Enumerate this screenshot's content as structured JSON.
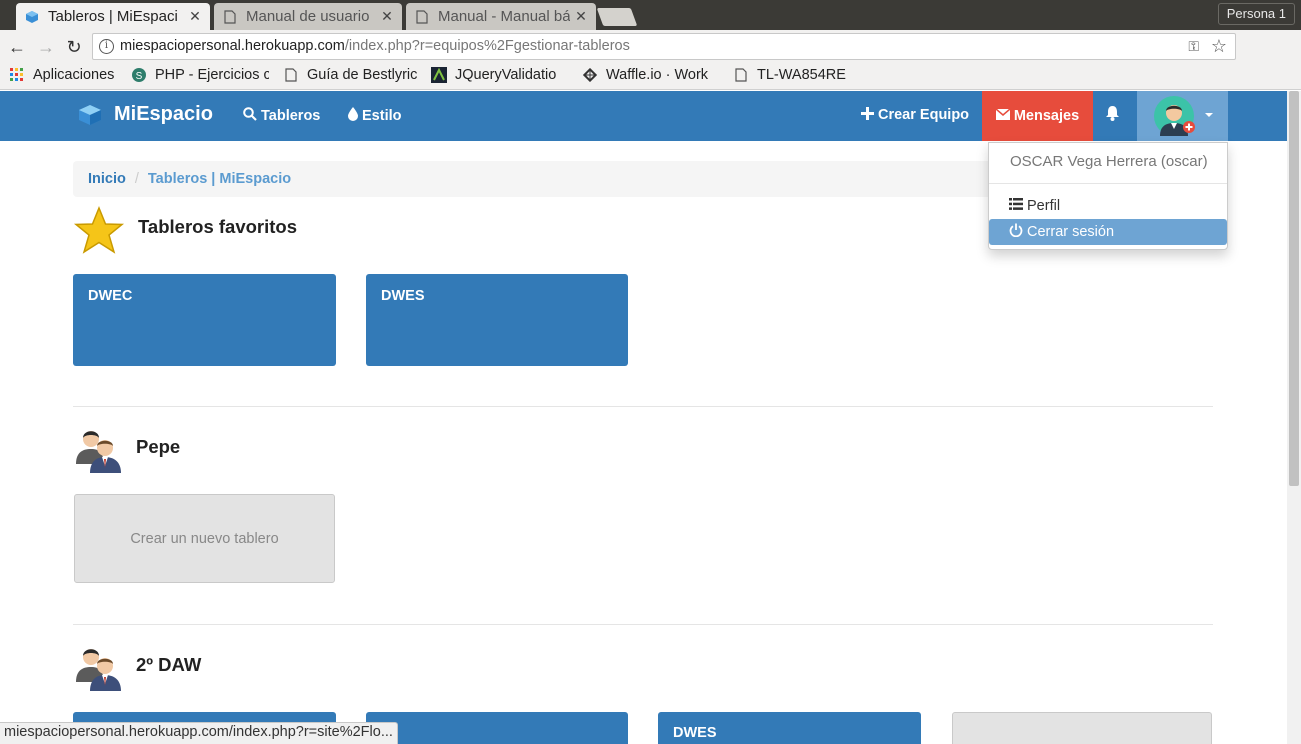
{
  "browser": {
    "tabs": [
      {
        "title": "Tableros | MiEspaci",
        "active": true
      },
      {
        "title": "Manual de usuario",
        "active": false
      },
      {
        "title": "Manual - Manual bá",
        "active": false
      }
    ],
    "profile": "Persona 1",
    "url": {
      "host": "miespaciopersonal.herokuapp.com",
      "path": "/index.php?r=equipos%2Fgestionar-tableros"
    },
    "bookmarks": [
      {
        "label": "Aplicaciones",
        "icon": "apps-grid-icon"
      },
      {
        "label": "PHP - Ejercicios c",
        "icon": "site-favicon"
      },
      {
        "label": "Guía de Bestlyric",
        "icon": "page-icon"
      },
      {
        "label": "JQueryValidatio",
        "icon": "site-favicon"
      },
      {
        "label": "Waffle.io · Work",
        "icon": "waffle-icon"
      },
      {
        "label": "TL-WA854RE",
        "icon": "page-icon"
      }
    ]
  },
  "navbar": {
    "brand": "MiEspacio",
    "links": [
      {
        "label": "Tableros",
        "icon": "search-icon"
      },
      {
        "label": "Estilo",
        "icon": "droplet-icon"
      }
    ],
    "crear_equipo": "Crear Equipo",
    "mensajes": "Mensajes",
    "colors": {
      "navbar": "#337ab7",
      "mensajes": "#e74c3c",
      "active": "#6ea4d3"
    }
  },
  "user_menu": {
    "name": "OSCAR Vega Herrera (oscar)",
    "items": [
      {
        "label": "Perfil",
        "icon": "list-icon"
      },
      {
        "label": "Cerrar sesión",
        "icon": "power-icon"
      }
    ]
  },
  "breadcrumb": {
    "home": "Inicio",
    "current": "Tableros | MiEspacio"
  },
  "sections": {
    "favoritos": {
      "title": "Tableros favoritos",
      "boards": [
        "DWEC",
        "DWES"
      ]
    },
    "pepe": {
      "title": "Pepe",
      "new_board": "Crear un nuevo tablero"
    },
    "daw": {
      "title": "2º DAW",
      "boards": [
        "",
        "",
        "DWES"
      ]
    }
  },
  "status": "miespaciopersonal.herokuapp.com/index.php?r=site%2Flo..."
}
